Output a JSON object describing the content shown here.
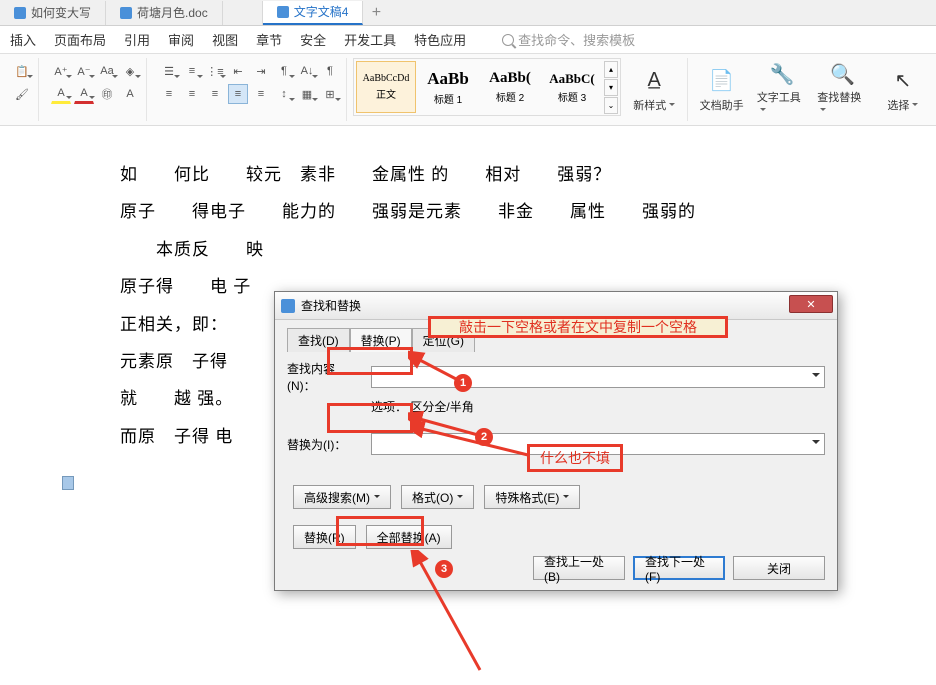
{
  "tabs": {
    "items": [
      {
        "label": "如何变大写"
      },
      {
        "label": "荷塘月色.doc"
      },
      {
        "label": "文字文稿4"
      }
    ]
  },
  "menu": {
    "items": [
      "插入",
      "页面布局",
      "引用",
      "审阅",
      "视图",
      "章节",
      "安全",
      "开发工具",
      "特色应用"
    ],
    "search_hint": "查找命令、搜索模板"
  },
  "styles": {
    "items": [
      {
        "preview": "AaBbCcDd",
        "label": "正文"
      },
      {
        "preview": "AaBb",
        "label": "标题 1"
      },
      {
        "preview": "AaBb(",
        "label": "标题 2"
      },
      {
        "preview": "AaBbC(",
        "label": "标题 3"
      }
    ],
    "new_style": "新样式",
    "doc_helper": "文档助手",
    "text_tool": "文字工具",
    "find_replace": "查找替换",
    "select": "选择"
  },
  "document": {
    "lines": [
      "如　　何比　　较元　素非　　金属性 的　　相对　　强弱？",
      "原子　　得电子　　能力的　　强弱是元素　　非金　　属性　　强弱的",
      "　　本质反　　映",
      "原子得　　电  子",
      "正相关，即：",
      "元素原　子得",
      "就　　越 强。",
      "而原　子得 电"
    ]
  },
  "dialog": {
    "title": "查找和替换",
    "tabs": {
      "find": "查找(D)",
      "replace": "替换(P)",
      "goto": "定位(G)"
    },
    "find_label": "查找内容(N)：",
    "find_value": " ",
    "options_label": "选项：",
    "options_value": "区分全/半角",
    "replace_label": "替换为(I)：",
    "replace_value": "",
    "adv_search": "高级搜索(M)",
    "format": "格式(O)",
    "special": "特殊格式(E)",
    "replace_btn": "替换(R)",
    "replace_all": "全部替换(A)",
    "find_prev": "查找上一处(B)",
    "find_next": "查找下一处(F)",
    "close": "关闭"
  },
  "annotations": {
    "tip1": "敲击一下空格或者在文中复制一个空格",
    "tip2": "什么也不填"
  }
}
